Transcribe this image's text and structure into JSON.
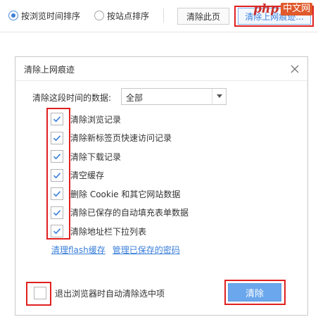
{
  "toolbar": {
    "sort_by_time": "按浏览时间排序",
    "sort_by_site": "按站点排序",
    "clear_page_button": "清除此页",
    "clear_history_button": "清除上网痕迹..."
  },
  "watermark": {
    "php": "php",
    "cn": "中文网"
  },
  "dialog": {
    "title": "清除上网痕迹",
    "range_label": "清除这段时间的数据:",
    "range_value": "全部",
    "options": [
      {
        "label": "清除浏览记录",
        "checked": true
      },
      {
        "label": "清除新标签页快速访问记录",
        "checked": true
      },
      {
        "label": "清除下载记录",
        "checked": true
      },
      {
        "label": "清空缓存",
        "checked": true
      },
      {
        "label": "删除 Cookie 和其它网站数据",
        "checked": true
      },
      {
        "label": "清除已保存的自动填充表单数据",
        "checked": true
      },
      {
        "label": "清除地址栏下拉列表",
        "checked": true
      }
    ],
    "links": {
      "flash_cache": "清理flash缓存",
      "saved_passwords": "管理已保存的密码"
    },
    "auto_clear_label": "退出浏览器时自动清除选中项",
    "auto_clear_checked": false,
    "clear_button": "清除"
  },
  "colors": {
    "accent": "#3b7fd9",
    "primary_button": "#6aa7ec",
    "highlight": "#e02020"
  }
}
